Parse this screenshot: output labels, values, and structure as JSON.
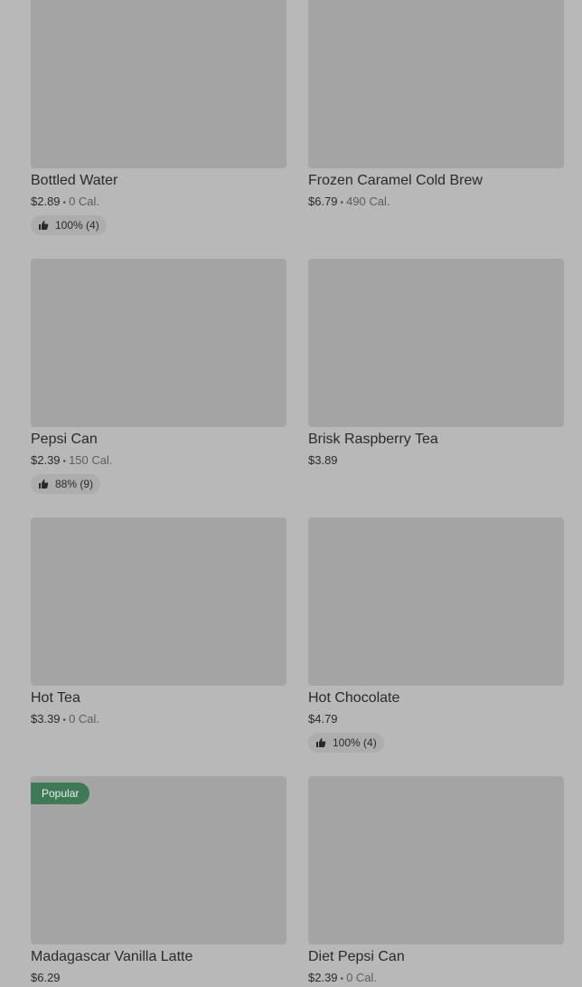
{
  "items": [
    {
      "name": "Bottled Water",
      "price": "$2.89",
      "cal": "0 Cal.",
      "rating": "100% (4)"
    },
    {
      "name": "Frozen Caramel Cold Brew",
      "price": "$6.79",
      "cal": "490 Cal.",
      "rating": null
    },
    {
      "name": "Pepsi Can",
      "price": "$2.39",
      "cal": "150 Cal.",
      "rating": "88% (9)"
    },
    {
      "name": "Brisk Raspberry Tea",
      "price": "$3.89",
      "cal": null,
      "rating": null
    },
    {
      "name": "Hot Tea",
      "price": "$3.39",
      "cal": "0 Cal.",
      "rating": null
    },
    {
      "name": "Hot Chocolate",
      "price": "$4.79",
      "cal": null,
      "rating": "100% (4)"
    },
    {
      "name": "Madagascar Vanilla Latte",
      "price": "$6.29",
      "cal": null,
      "rating": null,
      "badge": "Popular"
    },
    {
      "name": "Diet Pepsi Can",
      "price": "$2.39",
      "cal": "0 Cal.",
      "rating": null
    }
  ],
  "separator": "•",
  "colors": {
    "background": "#b8b8b8",
    "image_placeholder": "#a4a4a4",
    "badge": "#3f7a57"
  }
}
